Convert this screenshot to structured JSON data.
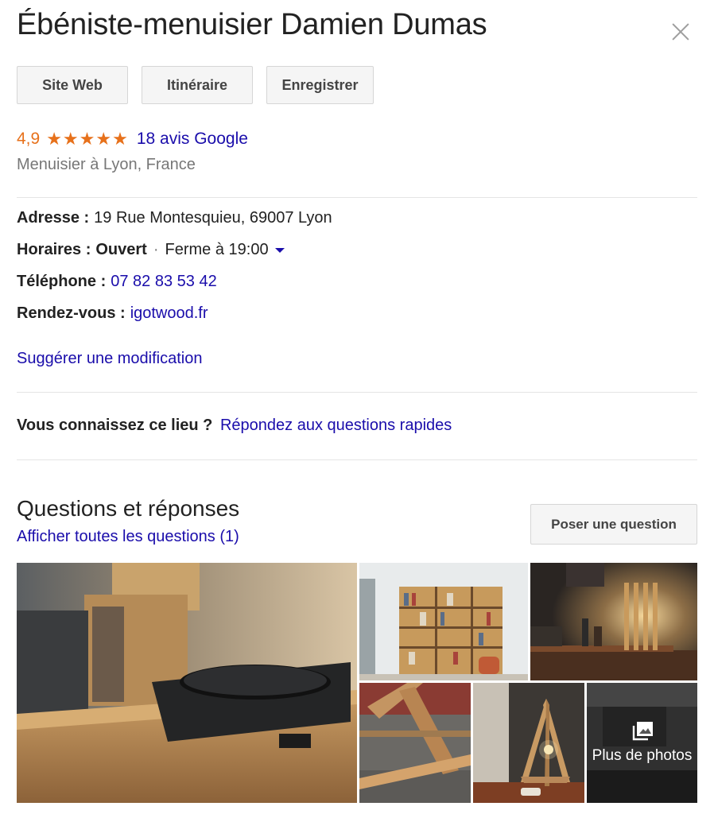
{
  "business": {
    "name": "Ébéniste-menuisier Damien Dumas",
    "rating": "4,9",
    "stars": "★★★★★",
    "reviews_link": "18 avis Google",
    "category": "Menuisier à Lyon, France"
  },
  "actions": {
    "website": "Site Web",
    "directions": "Itinéraire",
    "save": "Enregistrer"
  },
  "info": {
    "address_label": "Adresse :",
    "address_value": "19 Rue Montesquieu, 69007 Lyon",
    "hours_label": "Horaires :",
    "hours_status": "Ouvert",
    "hours_separator": "·",
    "hours_value": "Ferme à 19:00",
    "phone_label": "Téléphone :",
    "phone_value": "07 82 83 53 42",
    "appointment_label": "Rendez-vous :",
    "appointment_value": "igotwood.fr"
  },
  "suggest_edit": "Suggérer une modification",
  "know_place": {
    "label": "Vous connaissez ce lieu ?",
    "link": "Répondez aux questions rapides"
  },
  "qa": {
    "title": "Questions et réponses",
    "all_link": "Afficher toutes les questions (1)",
    "ask_button": "Poser une question"
  },
  "photos": {
    "more_label": "Plus de photos",
    "more_icon": "photo-library-icon"
  },
  "colors": {
    "link": "#1a0dab",
    "rating": "#e7711b",
    "button_bg": "#f5f5f5",
    "divider": "#e5e5e5"
  }
}
